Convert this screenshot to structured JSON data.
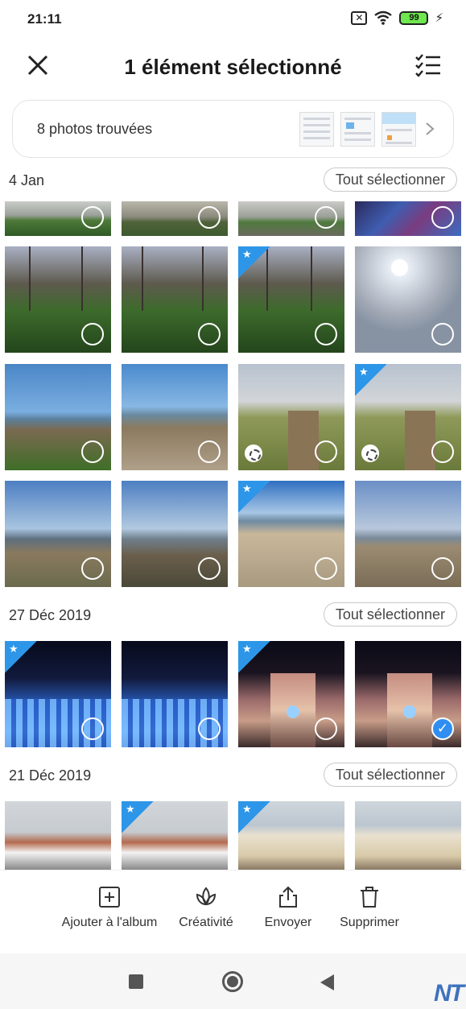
{
  "status_bar": {
    "time": "21:11",
    "battery": "99"
  },
  "header": {
    "title": "1 élément sélectionné"
  },
  "found": {
    "label": "8 photos trouvées"
  },
  "sections": [
    {
      "date": "4 Jan",
      "select_all": "Tout sélectionner"
    },
    {
      "date": "27 Déc 2019",
      "select_all": "Tout sélectionner"
    },
    {
      "date": "21 Déc 2019",
      "select_all": "Tout sélectionner"
    }
  ],
  "actions": {
    "add_album": "Ajouter à l'album",
    "creativity": "Créativité",
    "send": "Envoyer",
    "delete": "Supprimer"
  },
  "icons": {
    "close": "close-icon",
    "checklist": "checklist-icon",
    "chevron": "chevron-right-icon",
    "favorite": "star-icon",
    "live": "aperture-icon",
    "add_album": "plus-square-icon",
    "creativity": "lotus-icon",
    "send": "share-icon",
    "delete": "trash-icon"
  },
  "colors": {
    "accent": "#2f8ef0",
    "favorite": "#2d96e8",
    "battery": "#6ee84e"
  },
  "watermark": "NT"
}
